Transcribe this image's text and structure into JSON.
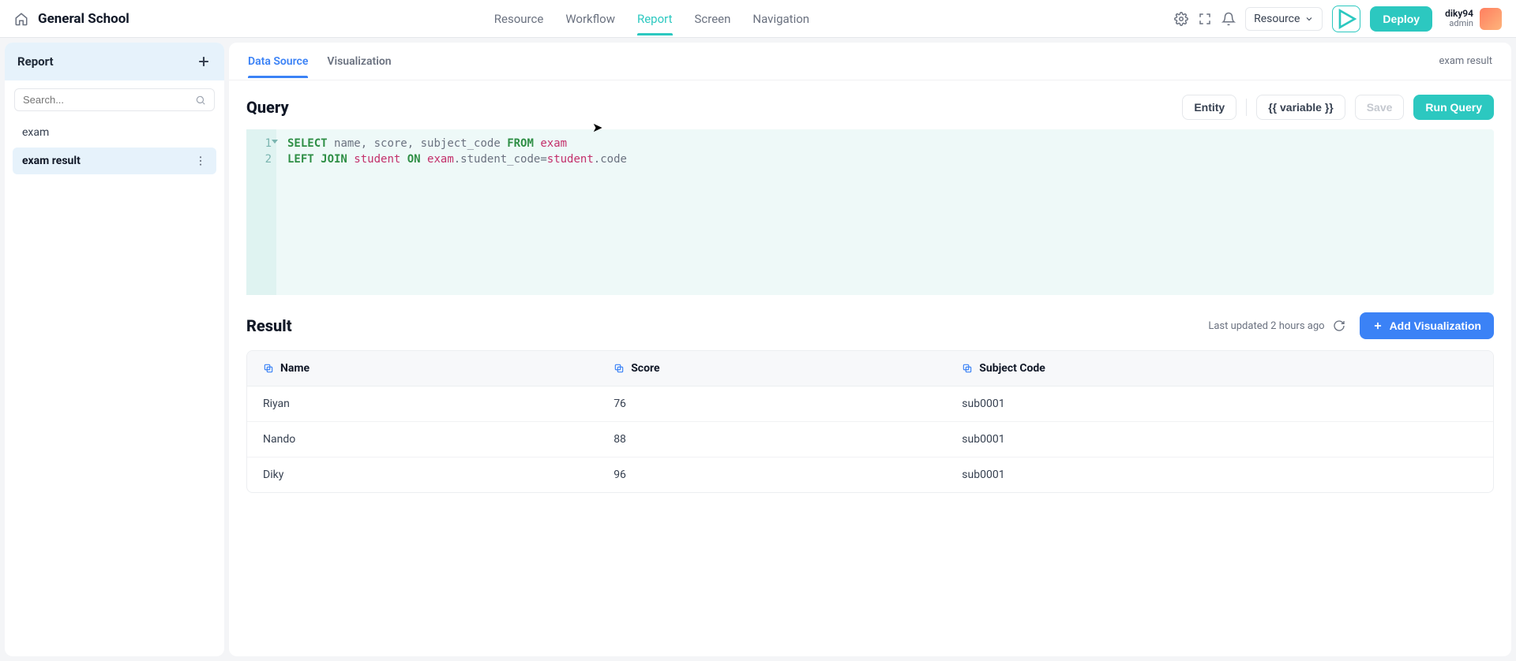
{
  "app_title": "General School",
  "header_nav": {
    "items": [
      "Resource",
      "Workflow",
      "Report",
      "Screen",
      "Navigation"
    ],
    "active": "Report"
  },
  "resource_dd_label": "Resource",
  "deploy_label": "Deploy",
  "user": {
    "name": "diky94",
    "role": "admin"
  },
  "sidebar": {
    "title": "Report",
    "search_placeholder": "Search...",
    "items": [
      {
        "label": "exam",
        "active": false
      },
      {
        "label": "exam result",
        "active": true
      }
    ]
  },
  "main_tabs": {
    "items": [
      "Data Source",
      "Visualization"
    ],
    "active": "Data Source"
  },
  "breadcrumb": "exam result",
  "query": {
    "title": "Query",
    "entity_btn": "Entity",
    "variable_btn": "{{ variable }}",
    "save_btn": "Save",
    "run_btn": "Run Query",
    "lines": [
      {
        "num": 1,
        "foldable": true,
        "tokens": [
          {
            "t": "SELECT ",
            "c": "kw"
          },
          {
            "t": "name",
            "c": "ident"
          },
          {
            "t": ", ",
            "c": "ident"
          },
          {
            "t": "score",
            "c": "ident"
          },
          {
            "t": ", ",
            "c": "ident"
          },
          {
            "t": "subject_code ",
            "c": "ident"
          },
          {
            "t": "FROM ",
            "c": "kw"
          },
          {
            "t": "exam",
            "c": "tbl"
          }
        ]
      },
      {
        "num": 2,
        "foldable": false,
        "tokens": [
          {
            "t": "LEFT JOIN ",
            "c": "kw"
          },
          {
            "t": "student ",
            "c": "tbl"
          },
          {
            "t": "ON ",
            "c": "kw"
          },
          {
            "t": "exam",
            "c": "tbl"
          },
          {
            "t": ".student_code=",
            "c": "ident"
          },
          {
            "t": "student",
            "c": "tbl"
          },
          {
            "t": ".code",
            "c": "ident"
          }
        ]
      }
    ]
  },
  "result": {
    "title": "Result",
    "updated": "Last updated 2 hours ago",
    "addviz_btn": "Add Visualization",
    "columns": [
      "Name",
      "Score",
      "Subject Code"
    ],
    "rows": [
      {
        "name": "Riyan",
        "score": "76",
        "subject": "sub0001"
      },
      {
        "name": "Nando",
        "score": "88",
        "subject": "sub0001"
      },
      {
        "name": "Diky",
        "score": "96",
        "subject": "sub0001"
      }
    ]
  }
}
